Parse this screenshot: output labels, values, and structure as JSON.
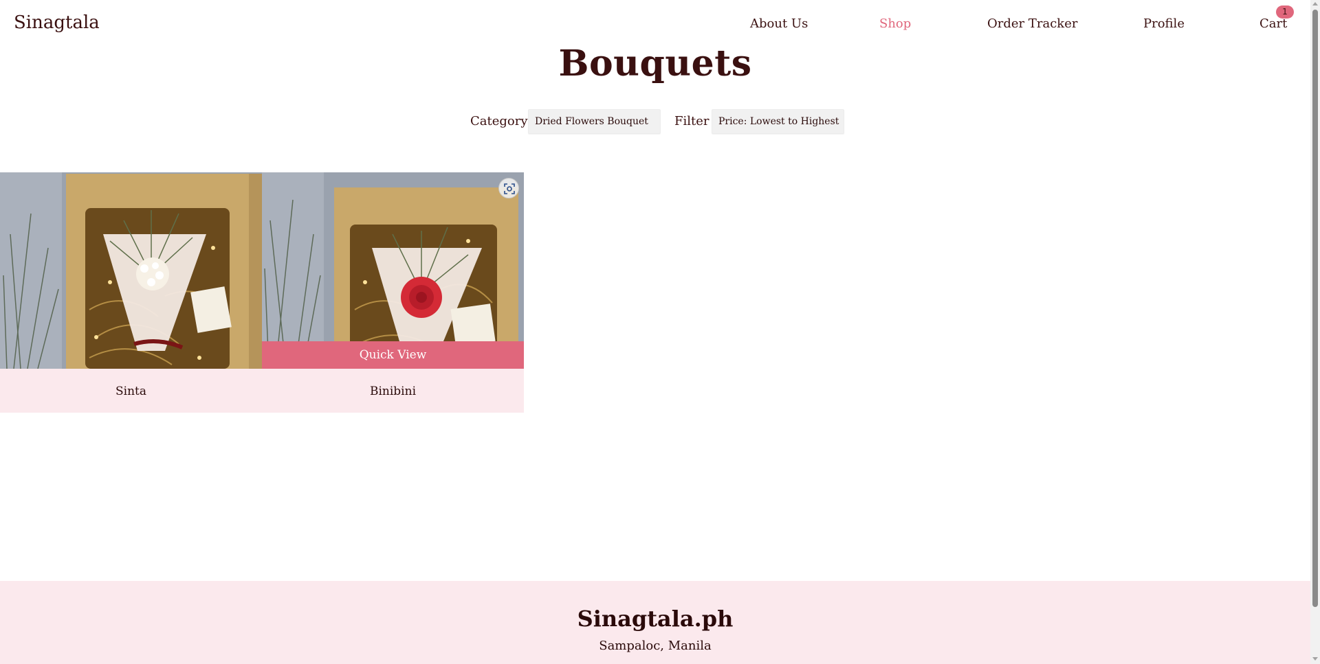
{
  "header": {
    "brand": "Sinagtala",
    "nav": [
      {
        "label": "About Us",
        "active": false
      },
      {
        "label": "Shop",
        "active": true
      },
      {
        "label": "Order Tracker",
        "active": false
      },
      {
        "label": "Profile",
        "active": false
      },
      {
        "label": "Cart",
        "active": false
      }
    ],
    "cart_count": "1"
  },
  "page": {
    "title": "Bouquets"
  },
  "filters": {
    "category_label": "Category",
    "category_value": "Dried Flowers Bouquet",
    "filter_label": "Filter",
    "filter_value": "Price: Lowest to Highest"
  },
  "products": [
    {
      "name": "Sinta"
    },
    {
      "name": "Binibini",
      "quick_view_label": "Quick View"
    }
  ],
  "footer": {
    "brand": "Sinagtala.ph",
    "location": "Sampaloc, Manila"
  },
  "colors": {
    "accent": "#e0677c",
    "text": "#3a1010",
    "card_bg": "#fbe9ed",
    "footer_bg": "#fbe9ed"
  }
}
